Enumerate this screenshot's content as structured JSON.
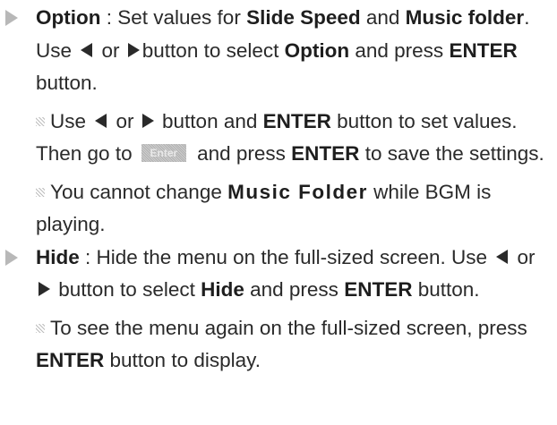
{
  "option": {
    "name": "Option",
    "desc_1": " : Set values for ",
    "slide_speed": "Slide Speed",
    "and": " and ",
    "music_folder": "Music folder",
    "desc_2": ". Use ",
    "or": " or ",
    "desc_3": "button to select ",
    "desc_4": " and press ",
    "enter": "ENTER",
    "button": " button.",
    "note1": {
      "t1": "Use ",
      "t2": " or ",
      "t3": " button and ",
      "t4": " button to set values. Then go to ",
      "chip": "Enter",
      "t5": " and press ",
      "t6": " to save the settings."
    },
    "note2": {
      "t1": "You cannot change ",
      "music_folder": "Music Folder",
      "t2": "  while BGM is playing."
    }
  },
  "hide": {
    "name": "Hide",
    "desc_1": " : Hide the menu on the full-sized screen. Use ",
    "or": " or ",
    "desc_2": " button to select ",
    "desc_3": " and press ",
    "enter": "ENTER",
    "button": " button.",
    "note1": {
      "t1": "To see the menu again on the full-sized screen, press ",
      "t2": " button to display."
    }
  },
  "icons": {
    "bullet": "triangle-bullet-icon",
    "note": "note-square-icon",
    "left": "left-arrow-icon",
    "right": "right-arrow-icon"
  }
}
